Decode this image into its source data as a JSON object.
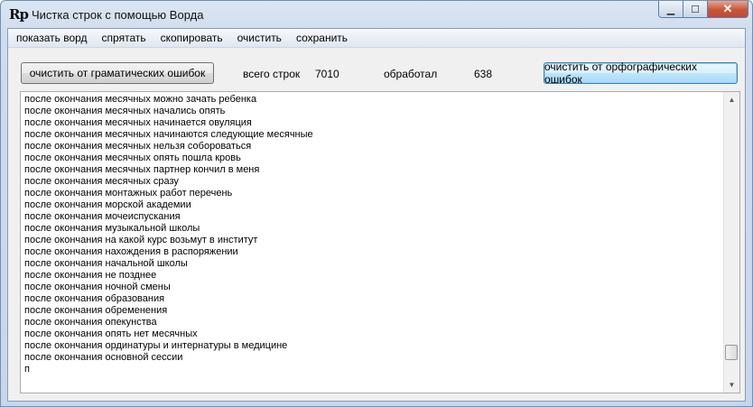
{
  "window": {
    "title": "Чистка строк с помощью Ворда",
    "app_icon_text": "Rp",
    "controls": {
      "minimize": "▁",
      "maximize": "☐",
      "close": "✕"
    }
  },
  "menu": [
    "показать ворд",
    "спрятать",
    "скопировать",
    "очистить",
    "сохранить"
  ],
  "toolbar": {
    "grammar_button": "очистить от граматических ошибок",
    "total_label": "всего строк",
    "total_value": "7010",
    "processed_label": "обработал",
    "processed_value": "638",
    "spelling_button": "очистить от орфографических ошибок"
  },
  "text_lines": [
    "после окончания месячных можно зачать ребенка",
    "после окончания месячных начались опять",
    "после окончания месячных начинается овуляция",
    "после окончания месячных начинаются следующие месячные",
    "после окончания месячных нельзя собороваться",
    "после окончания месячных опять пошла кровь",
    "после окончания месячных партнер кончил в меня",
    "после окончания месячных сразу",
    "после окончания монтажных работ перечень",
    "после окончания морской академии",
    "после окончания мочеиспускания",
    "после окончания музыкальной школы",
    "после окончания на какой курс возьмут в институт",
    "после окончания нахождения в распоряжении",
    "после окончания начальной школы",
    "после окончания не позднее",
    "после окончания ночной смены",
    "после окончания образования",
    "после окончания обременения",
    "после окончания опекунства",
    "после окончания опять нет месячных",
    "после окончания ординатуры и интернатуры в медицине",
    "после окончания основной сессии",
    "п"
  ],
  "scrollbar": {
    "up_arrow": "▲",
    "down_arrow": "▼"
  }
}
